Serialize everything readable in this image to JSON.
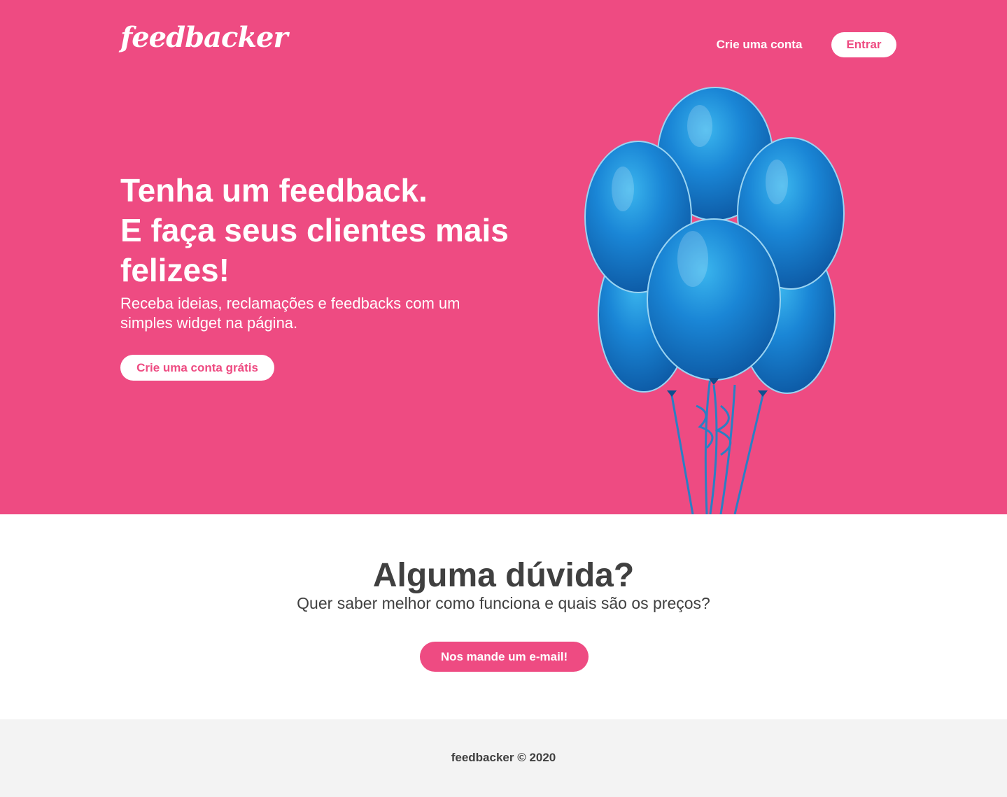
{
  "colors": {
    "brand": "#ee4b82",
    "text_dark": "#404040",
    "footer_bg": "#f3f3f3",
    "balloon": "#1a86d6"
  },
  "header": {
    "logo": "feedbacker",
    "create_account_link": "Crie uma conta",
    "login_button": "Entrar"
  },
  "hero": {
    "title_lines": [
      "Tenha um feedback.",
      "E faça seus clientes mais",
      "felizes!"
    ],
    "subtitle": "Receba ideias, reclamações e feedbacks com um simples widget na página.",
    "cta_button": "Crie uma conta grátis",
    "image": "blue-balloons-image"
  },
  "contact": {
    "title": "Alguma dúvida?",
    "subtitle": "Quer saber melhor como funciona e quais são os preços?",
    "email_button": "Nos mande um e-mail!"
  },
  "footer": {
    "copyright": "feedbacker © 2020"
  }
}
